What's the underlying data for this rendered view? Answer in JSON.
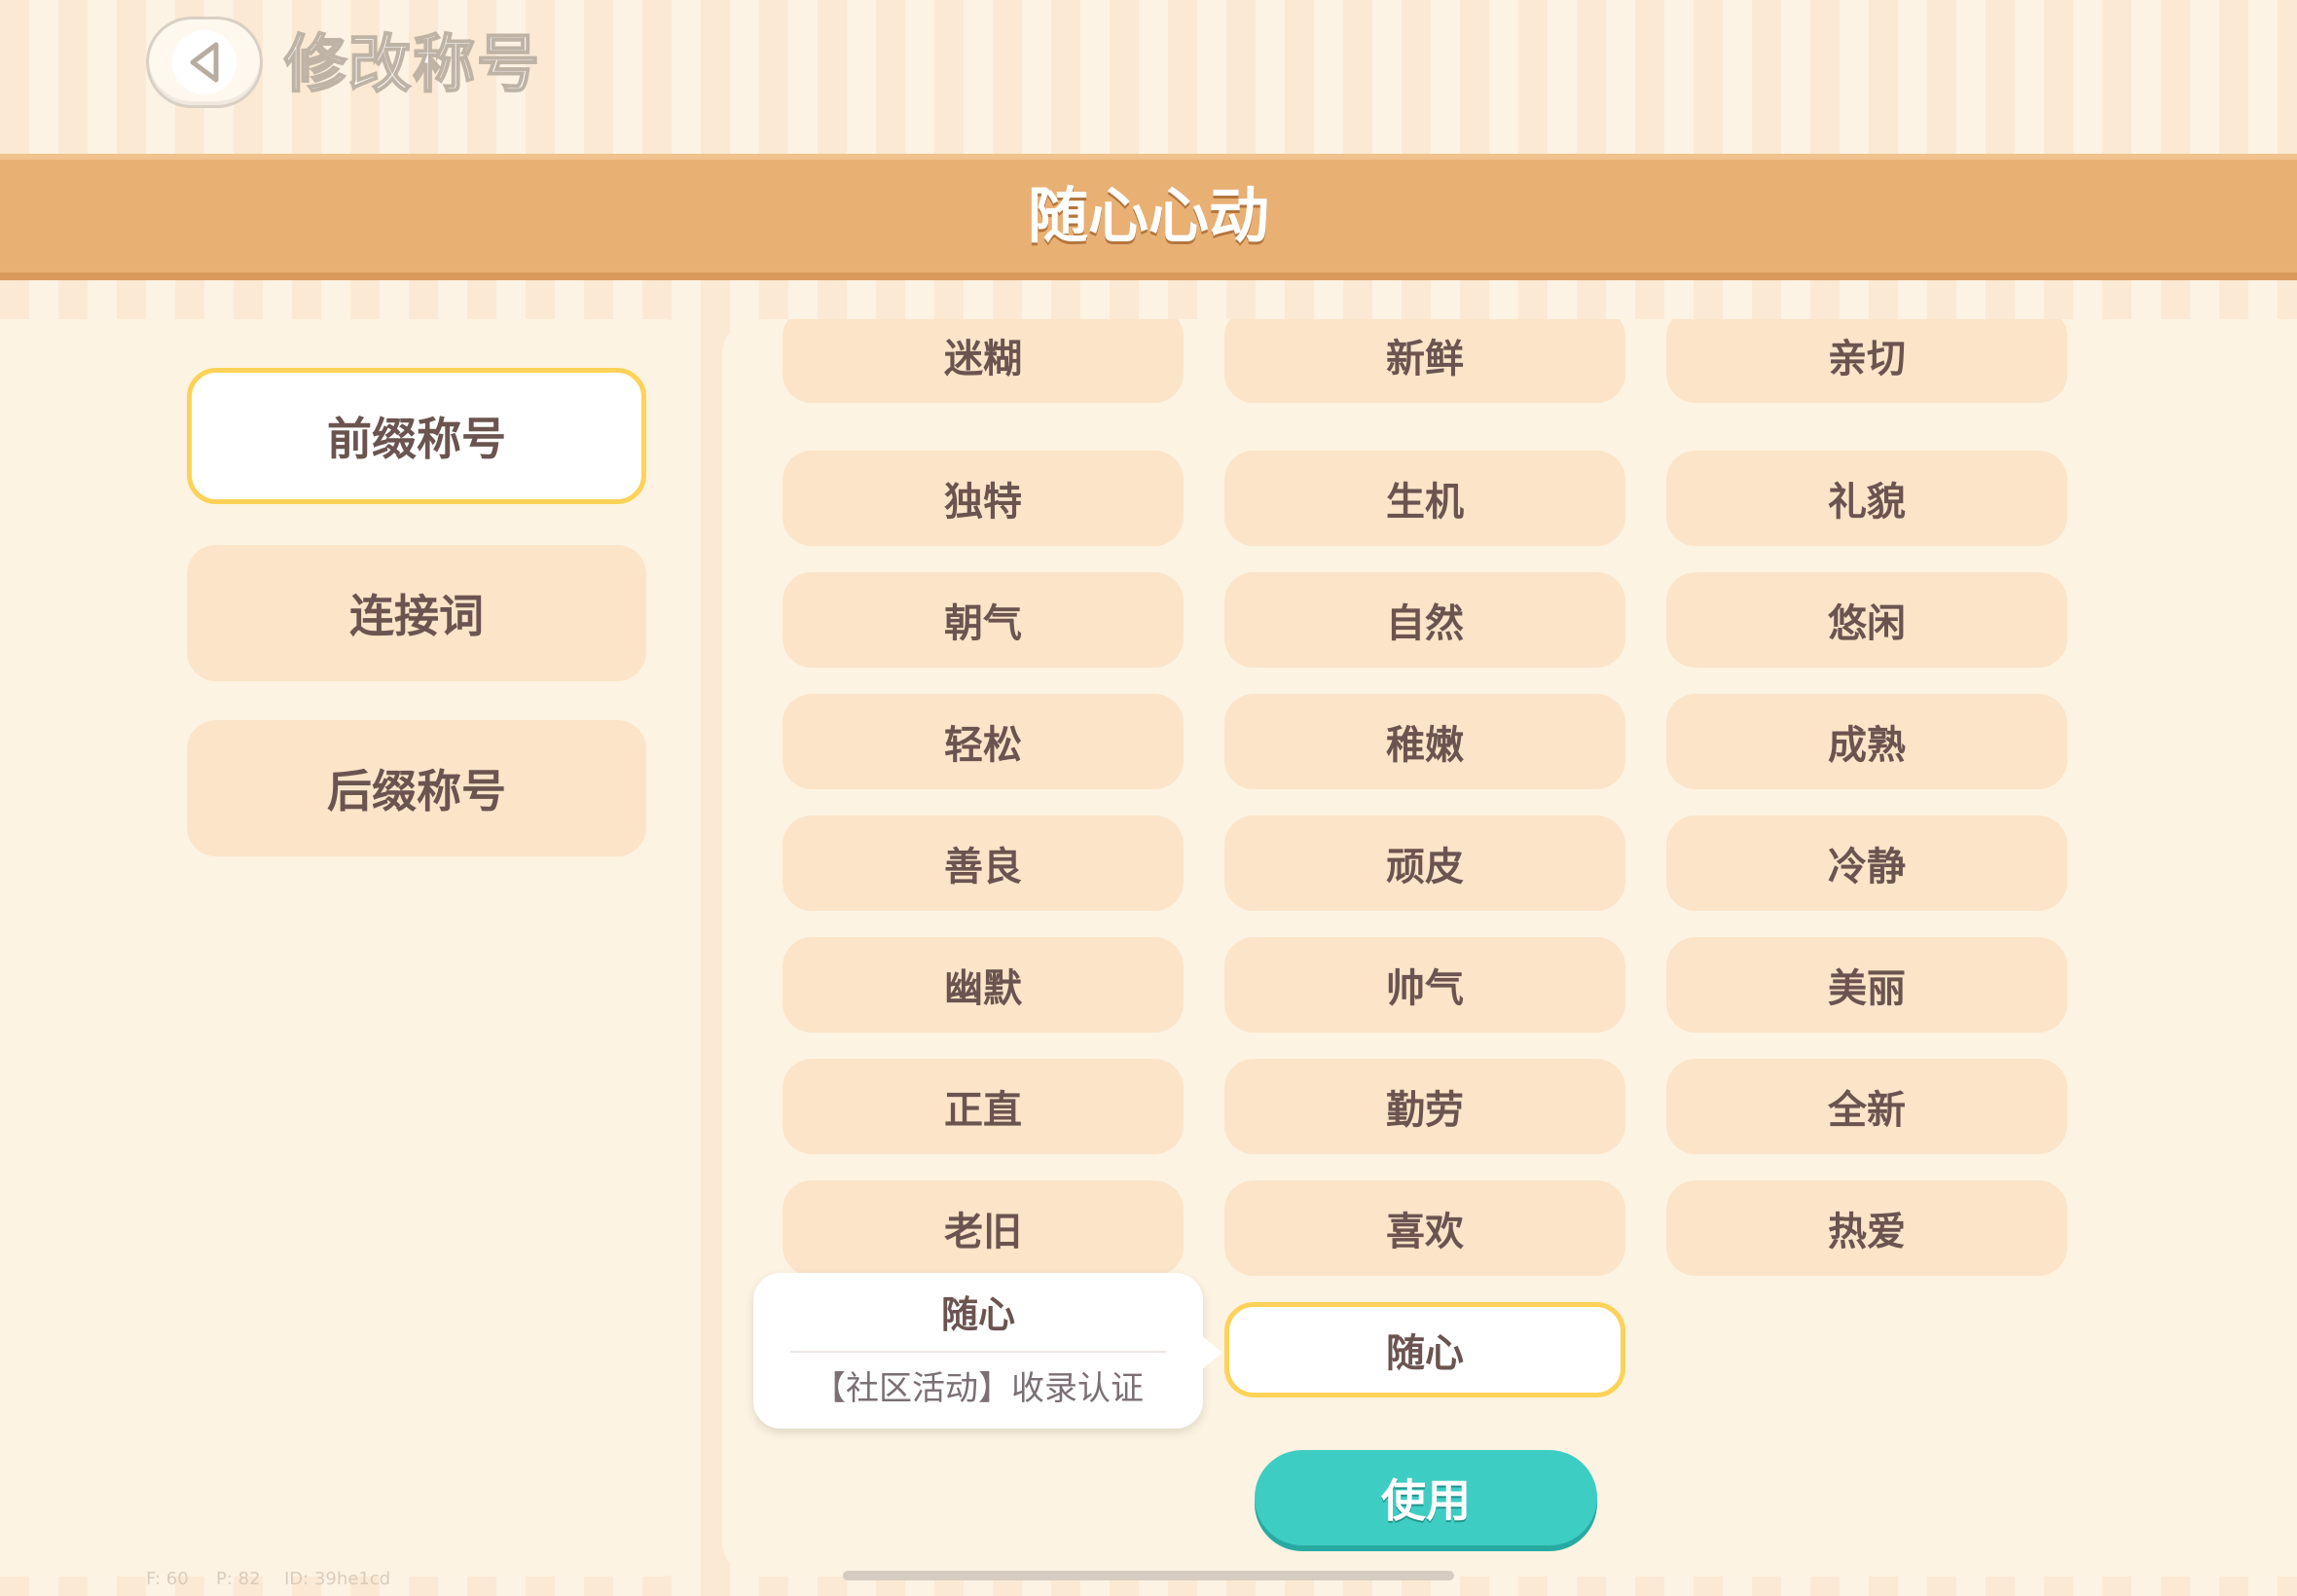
{
  "header": {
    "title": "修改称号",
    "banner_title": "随心心动"
  },
  "categories": [
    {
      "label": "前缀称号",
      "active": true
    },
    {
      "label": "连接词",
      "active": false
    },
    {
      "label": "后缀称号",
      "active": false
    }
  ],
  "words": [
    [
      "迷糊",
      "新鲜",
      "亲切"
    ],
    [
      "独特",
      "生机",
      "礼貌"
    ],
    [
      "朝气",
      "自然",
      "悠闲"
    ],
    [
      "轻松",
      "稚嫩",
      "成熟"
    ],
    [
      "善良",
      "顽皮",
      "冷静"
    ],
    [
      "幽默",
      "帅气",
      "美丽"
    ],
    [
      "正直",
      "勤劳",
      "全新"
    ],
    [
      "老旧",
      "喜欢",
      "热爱"
    ],
    [
      "",
      "随心",
      ""
    ]
  ],
  "tooltip": {
    "title": "随心",
    "description": "【社区活动】收录认证"
  },
  "use_button": "使用",
  "debug": {
    "f": "F: 60",
    "p": "P: 82",
    "id": "ID: 39he1cd"
  },
  "colors": {
    "banner": "#e9b074",
    "tile": "#fbe4c8",
    "selected_border": "#fcd258",
    "use_button": "#3ecdc3",
    "text": "#6b5450"
  }
}
